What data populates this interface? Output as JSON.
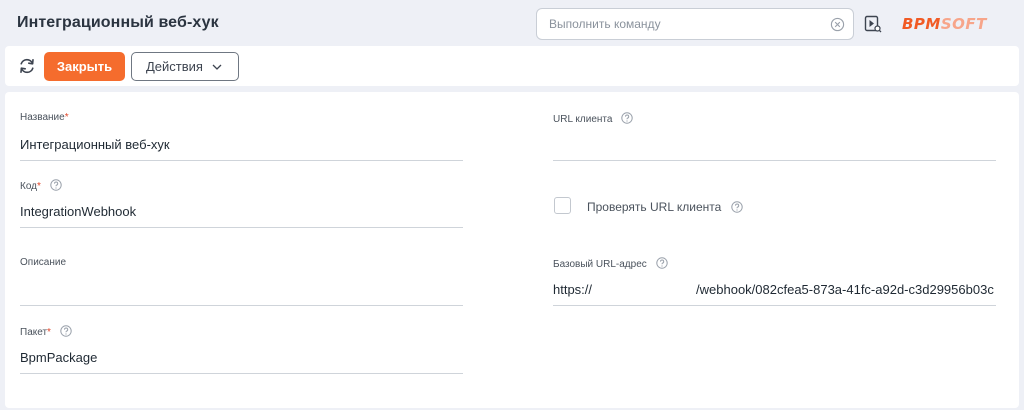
{
  "header": {
    "title": "Интеграционный веб-хук",
    "command_placeholder": "Выполнить команду",
    "logo_part1": "BPM",
    "logo_part2": "SOFT"
  },
  "toolbar": {
    "close_label": "Закрыть",
    "actions_label": "Действия"
  },
  "form": {
    "name": {
      "label": "Название",
      "required_mark": "*",
      "value": "Интеграционный веб-хук"
    },
    "code": {
      "label": "Код",
      "required_mark": "*",
      "value": "IntegrationWebhook"
    },
    "description": {
      "label": "Описание",
      "value": ""
    },
    "package": {
      "label": "Пакет",
      "required_mark": "*",
      "value": "BpmPackage"
    },
    "client_url": {
      "label": "URL клиента",
      "value": ""
    },
    "check_client_url": {
      "label": "Проверять URL клиента",
      "checked": false
    },
    "base_url": {
      "label": "Базовый URL-адрес",
      "value_prefix": "https://",
      "value_suffix": "/webhook/082cfea5-873a-41fc-a92d-c3d29956b03c"
    }
  },
  "colors": {
    "accent": "#f56c2d",
    "required": "#e0462a",
    "background": "#eef0f6"
  },
  "icons": {
    "clear": "clear-circle-x-icon",
    "play": "play-search-icon",
    "refresh": "refresh-icon",
    "chevron": "chevron-down-icon",
    "help": "question-circle-icon"
  }
}
